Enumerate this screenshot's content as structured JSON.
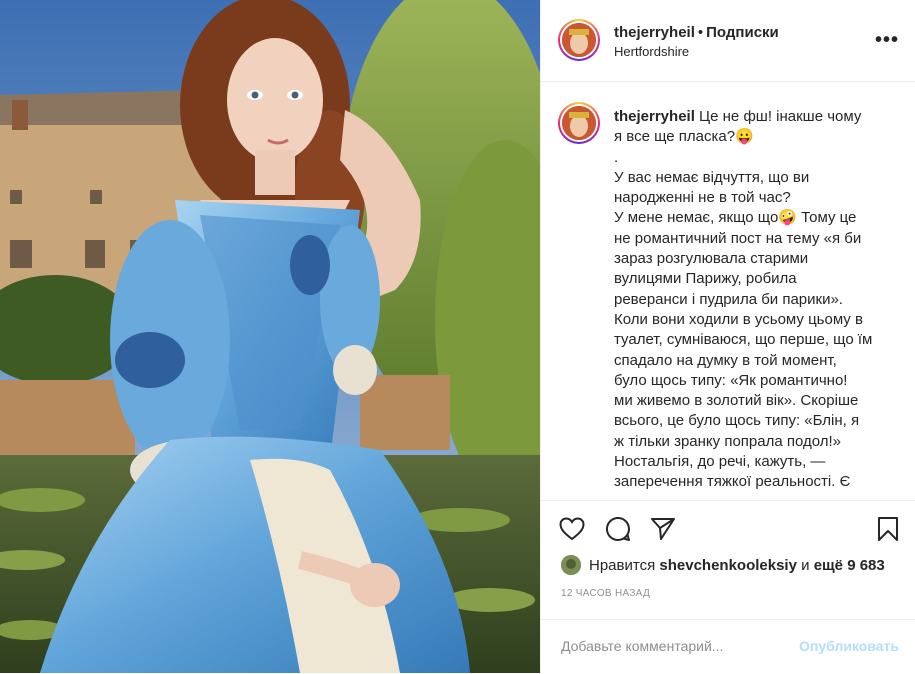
{
  "post": {
    "username": "thejerryheil",
    "separator": "•",
    "follow_label": "Подписки",
    "location": "Hertfordshire",
    "more_icon": "more-options-icon",
    "caption_lines": [
      "Це не фш! інакше чому",
      "я все ще пласка?😛",
      ".",
      "У вас немає відчуття, що ви",
      "народженні не в той час?",
      "У мене немає, якщо що🤪 Тому це",
      "не романтичний пост на тему «я би",
      "зараз розгулювала старими",
      "вулицями Парижу, робила",
      "реверанси і пудрила би парики».",
      "Коли вони ходили в усьому цьому в",
      "туалет, сумніваюся, що перше, що їм",
      "спадало на думку в той момент,",
      "було щось типу: «Як романтично!",
      "ми живемо в золотий вік». Скоріше",
      "всього, це було щось типу: «Блін, я",
      "ж тільки зранку попрала подол!»",
      "Ностальгія, до речі, кажуть, —",
      "заперечення тяжкої реальності. Є"
    ]
  },
  "actions": {
    "like_icon": "heart-icon",
    "comment_icon": "comment-icon",
    "share_icon": "share-icon",
    "save_icon": "bookmark-icon"
  },
  "likes": {
    "prefix": "Нравится",
    "liker": "shevchenkooleksiy",
    "middle": "и",
    "rest": "ещё 9 683"
  },
  "timestamp": "12 ЧАСОВ НАЗАД",
  "comment": {
    "placeholder": "Добавьте комментарий...",
    "publish_label": "Опубликовать"
  },
  "colors": {
    "text": "#262626",
    "muted": "#8e8e8e",
    "publish_disabled": "#b2dffc",
    "border": "#efefef"
  }
}
